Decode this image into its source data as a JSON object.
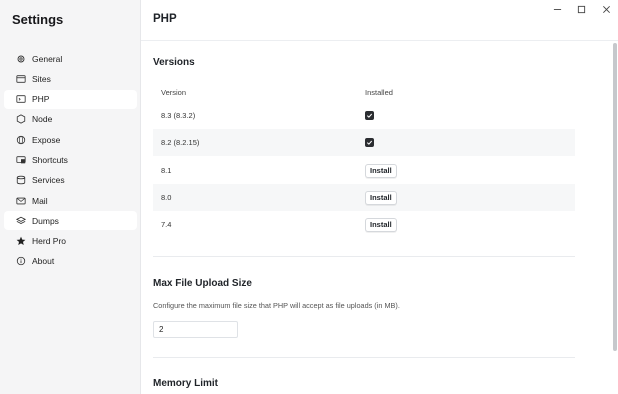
{
  "sidebar": {
    "title": "Settings",
    "items": [
      {
        "label": "General",
        "icon": "gear-icon"
      },
      {
        "label": "Sites",
        "icon": "window-icon"
      },
      {
        "label": "PHP",
        "icon": "code-icon"
      },
      {
        "label": "Node",
        "icon": "hexagon-icon"
      },
      {
        "label": "Expose",
        "icon": "globe-icon"
      },
      {
        "label": "Shortcuts",
        "icon": "shortcut-icon"
      },
      {
        "label": "Services",
        "icon": "database-icon"
      },
      {
        "label": "Mail",
        "icon": "mail-icon"
      },
      {
        "label": "Dumps",
        "icon": "layers-icon"
      },
      {
        "label": "Herd Pro",
        "icon": "star-icon"
      },
      {
        "label": "About",
        "icon": "info-icon"
      }
    ],
    "active": "PHP"
  },
  "header": {
    "title": "PHP"
  },
  "versions": {
    "title": "Versions",
    "col_version": "Version",
    "col_installed": "Installed",
    "install_label": "Install",
    "rows": [
      {
        "version": "8.3 (8.3.2)",
        "installed": true
      },
      {
        "version": "8.2 (8.2.15)",
        "installed": true
      },
      {
        "version": "8.1",
        "installed": false
      },
      {
        "version": "8.0",
        "installed": false
      },
      {
        "version": "7.4",
        "installed": false
      }
    ]
  },
  "upload": {
    "title": "Max File Upload Size",
    "description": "Configure the maximum file size that PHP will accept as file uploads (in MB).",
    "value": "2"
  },
  "memory": {
    "title": "Memory Limit"
  },
  "colors": {
    "sidebar_bg": "#f5f5f6",
    "checkbox": "#2b2d31"
  }
}
